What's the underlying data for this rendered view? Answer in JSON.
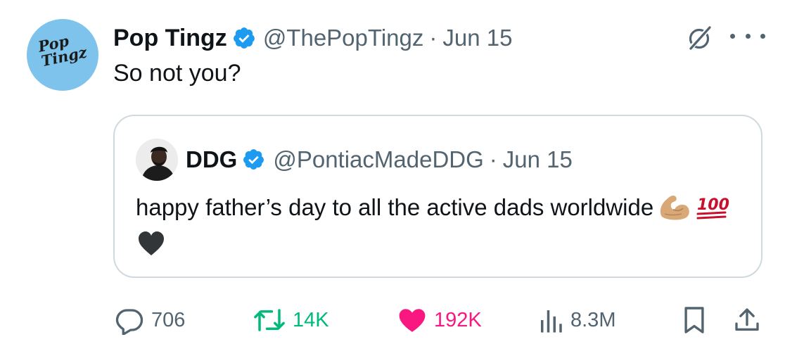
{
  "colors": {
    "verified": "#1d9bf0",
    "secondary_text": "#536471",
    "retweet_active": "#00ba7c",
    "like_active": "#f91880",
    "avatar_bg": "#7ec3ec",
    "quote_border": "#cfd9de"
  },
  "tweet": {
    "author": {
      "display_name": "Pop Tingz",
      "handle": "@ThePopTingz",
      "avatar_text": "Pop\nTingz",
      "verified_icon": "verified-badge-icon"
    },
    "separator": "·",
    "date": "Jun 15",
    "text": "So not you?",
    "header_icons": [
      "grok-icon",
      "more-icon"
    ]
  },
  "quote": {
    "author": {
      "display_name": "DDG",
      "handle": "@PontiacMadeDDG",
      "verified_icon": "verified-badge-icon"
    },
    "separator": "·",
    "date": "Jun 15",
    "text": "happy father’s day to all the active dads worldwide",
    "emojis": [
      "flexed-biceps-emoji",
      "hundred-points-emoji",
      "black-heart-emoji"
    ]
  },
  "actions": {
    "replies": {
      "count": "706",
      "icon": "reply-icon"
    },
    "reposts": {
      "count": "14K",
      "icon": "repost-icon",
      "active": true
    },
    "likes": {
      "count": "192K",
      "icon": "heart-icon",
      "active": true
    },
    "views": {
      "count": "8.3M",
      "icon": "views-icon"
    },
    "bookmark": {
      "icon": "bookmark-icon"
    },
    "share": {
      "icon": "share-icon"
    }
  }
}
